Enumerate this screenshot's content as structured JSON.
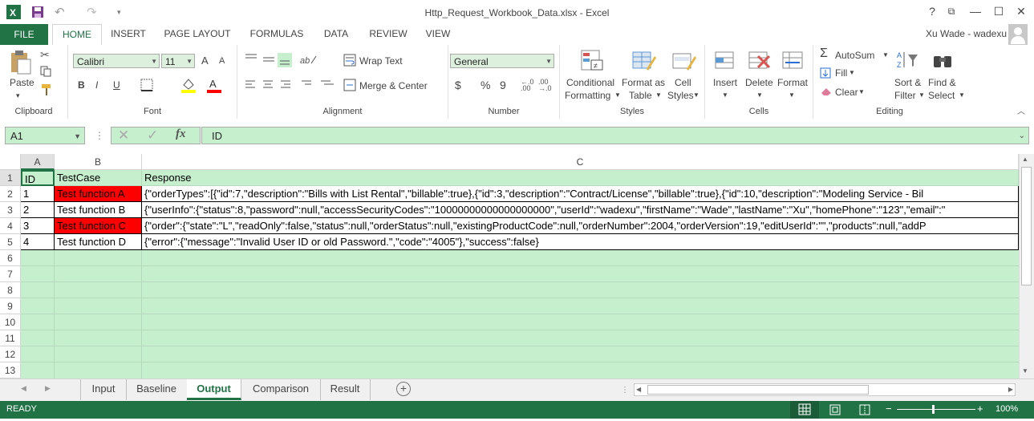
{
  "window": {
    "title": "Http_Request_Workbook_Data.xlsx - Excel",
    "help": "?",
    "restore": "⧉",
    "minimize": "—",
    "maximize": "☐",
    "close": "✕"
  },
  "ribbon_tabs": {
    "file": "FILE",
    "tabs": [
      "HOME",
      "INSERT",
      "PAGE LAYOUT",
      "FORMULAS",
      "DATA",
      "REVIEW",
      "VIEW"
    ],
    "user": "Xu Wade - wadexu"
  },
  "ribbon": {
    "clipboard": {
      "paste": "Paste",
      "label": "Clipboard"
    },
    "font": {
      "name": "Calibri",
      "size": "11",
      "bold": "B",
      "italic": "I",
      "underline": "U",
      "label": "Font",
      "grow": "A",
      "shrink": "A"
    },
    "alignment": {
      "wrap_text": "Wrap Text",
      "merge_center": "Merge & Center",
      "label": "Alignment"
    },
    "number": {
      "format": "General",
      "currency": "$",
      "percent": "%",
      "comma": "9",
      "label": "Number"
    },
    "styles": {
      "conditional_1": "Conditional",
      "conditional_2": "Formatting",
      "format_as_1": "Format as",
      "format_as_2": "Table",
      "cell_1": "Cell",
      "cell_2": "Styles",
      "label": "Styles"
    },
    "cells": {
      "insert": "Insert",
      "delete": "Delete",
      "format": "Format",
      "label": "Cells"
    },
    "editing": {
      "autosum": "AutoSum",
      "fill": "Fill",
      "clear": "Clear",
      "sort_1": "Sort &",
      "sort_2": "Filter",
      "find_1": "Find &",
      "find_2": "Select",
      "label": "Editing"
    }
  },
  "formula_bar": {
    "name_box": "A1",
    "fx": "fx",
    "content": "ID"
  },
  "columns": [
    "A",
    "B",
    "C"
  ],
  "rows": [
    "1",
    "2",
    "3",
    "4",
    "5",
    "6",
    "7",
    "8",
    "9",
    "10",
    "11",
    "12",
    "13"
  ],
  "table": [
    {
      "a": "ID",
      "b": "TestCase",
      "c": "Response"
    },
    {
      "a": "1",
      "b": "Test function A",
      "c": "{\"orderTypes\":[{\"id\":7,\"description\":\"Bills with List Rental\",\"billable\":true},{\"id\":3,\"description\":\"Contract/License\",\"billable\":true},{\"id\":10,\"description\":\"Modeling Service - Bil"
    },
    {
      "a": "2",
      "b": "Test function B",
      "c": "{\"userInfo\":{\"status\":8,\"password\":null,\"accessSecurityCodes\":\"10000000000000000000\",\"userId\":\"wadexu\",\"firstName\":\"Wade\",\"lastName\":\"Xu\",\"homePhone\":\"123\",\"email\":\""
    },
    {
      "a": "3",
      "b": "Test function C",
      "c": "{\"order\":{\"state\":\"L\",\"readOnly\":false,\"status\":null,\"orderStatus\":null,\"existingProductCode\":null,\"orderNumber\":2004,\"orderVersion\":19,\"editUserId\":\"\",\"products\":null,\"addP"
    },
    {
      "a": "4",
      "b": "Test function D",
      "c": "{\"error\":{\"message\":\"Invalid User ID or old Password.\",\"code\":\"4005\"},\"success\":false}"
    }
  ],
  "sheet_tabs": [
    "Input",
    "Baseline",
    "Output",
    "Comparison",
    "Result"
  ],
  "active_sheet": "Output",
  "status": {
    "ready": "READY",
    "zoom": "100%",
    "minus": "−",
    "plus": "+"
  },
  "colors": {
    "accent": "#217346",
    "sheet_bg": "#c6efce",
    "fail_fill": "#ff0000"
  }
}
